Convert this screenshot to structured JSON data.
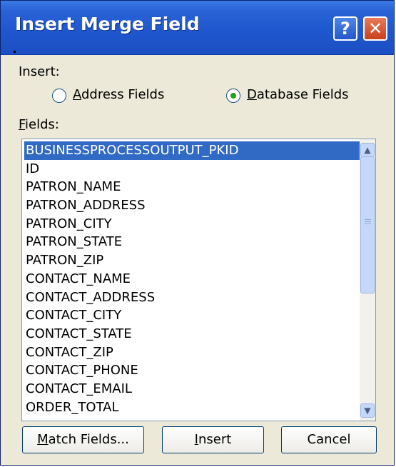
{
  "dialog": {
    "title": "Insert Merge Field",
    "help_icon": "question-mark",
    "close_icon": "x"
  },
  "insert_group": {
    "label": "Insert:",
    "options": [
      {
        "label_mnemonic": "A",
        "label_rest": "ddress Fields",
        "selected": false
      },
      {
        "label_mnemonic": "D",
        "label_rest": "atabase Fields",
        "selected": true
      }
    ]
  },
  "fields": {
    "label_mnemonic": "F",
    "label_rest": "ields:",
    "items": [
      "BUSINESSPROCESSOUTPUT_PKID",
      "ID",
      "PATRON_NAME",
      "PATRON_ADDRESS",
      "PATRON_CITY",
      "PATRON_STATE",
      "PATRON_ZIP",
      "CONTACT_NAME",
      "CONTACT_ADDRESS",
      "CONTACT_CITY",
      "CONTACT_STATE",
      "CONTACT_ZIP",
      "CONTACT_PHONE",
      "CONTACT_EMAIL",
      "ORDER_TOTAL"
    ],
    "selected_index": 0
  },
  "buttons": {
    "match": {
      "mnemonic": "M",
      "rest": "atch Fields..."
    },
    "insert": {
      "mnemonic": "I",
      "rest": "nsert"
    },
    "cancel": {
      "label": "Cancel"
    }
  },
  "colors": {
    "titlebar": "#2a63d6",
    "selection": "#316ac5",
    "dialog_bg": "#ece9d8"
  }
}
